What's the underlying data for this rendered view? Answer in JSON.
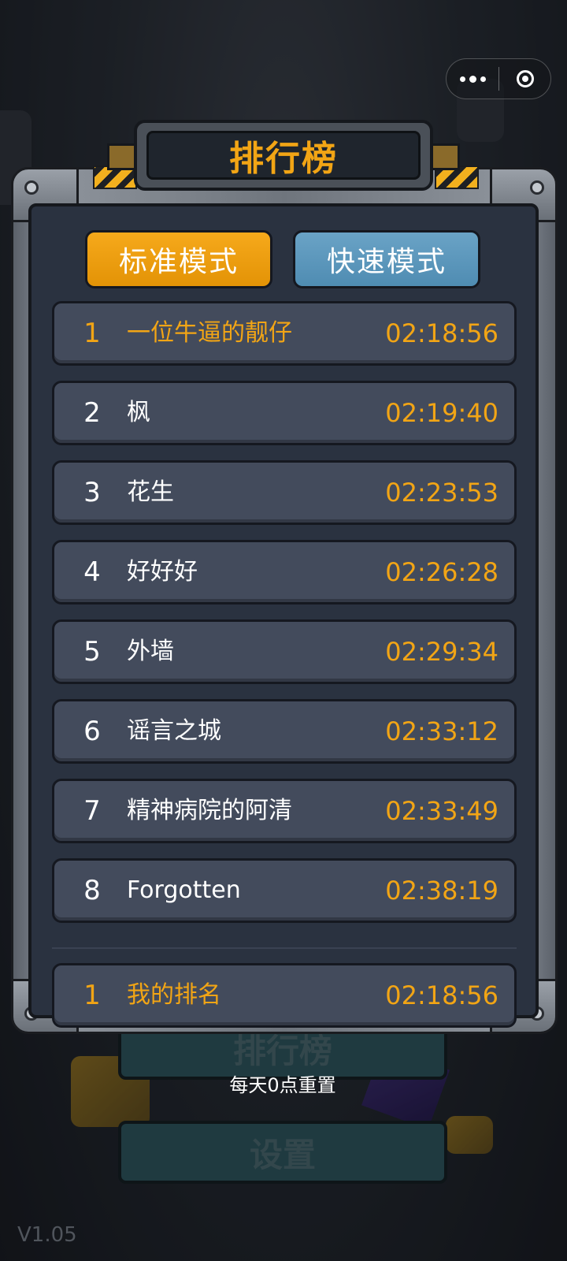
{
  "capsule": {
    "more_icon": "more-dots-icon",
    "close_icon": "target-circle-icon"
  },
  "leaderboard": {
    "title": "排行榜",
    "tabs": [
      {
        "label": "标准模式",
        "active": true
      },
      {
        "label": "快速模式",
        "active": false
      }
    ],
    "entries": [
      {
        "rank": "1",
        "name": "一位牛逼的靓仔",
        "time": "02:18:56"
      },
      {
        "rank": "2",
        "name": "枫",
        "time": "02:19:40"
      },
      {
        "rank": "3",
        "name": "花生",
        "time": "02:23:53"
      },
      {
        "rank": "4",
        "name": "好好好",
        "time": "02:26:28"
      },
      {
        "rank": "5",
        "name": "外墙",
        "time": "02:29:34"
      },
      {
        "rank": "6",
        "name": "谣言之城",
        "time": "02:33:12"
      },
      {
        "rank": "7",
        "name": "精神病院的阿清",
        "time": "02:33:49"
      },
      {
        "rank": "8",
        "name": "Forgotten",
        "time": "02:38:19"
      }
    ],
    "my_rank": {
      "rank": "1",
      "name": "我的排名",
      "time": "02:18:56"
    }
  },
  "menu": {
    "leaderboard_label": "排行榜",
    "reset_note": "每天0点重置",
    "settings_label": "设置"
  },
  "version": "V1.05",
  "colors": {
    "accent": "#f2a515",
    "tab_active": "#f6a91b",
    "tab_inactive": "#5a98bd",
    "row_bg": "#434b5c",
    "panel_bg": "#2a3240"
  }
}
